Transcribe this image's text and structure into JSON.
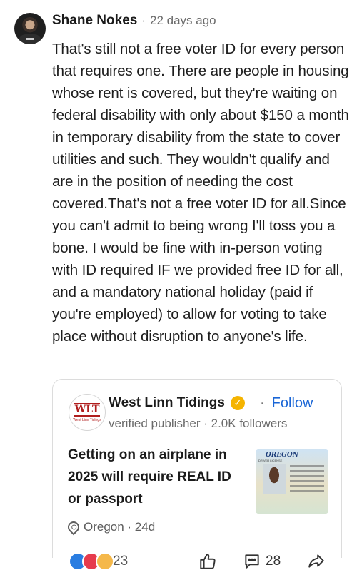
{
  "comment": {
    "author": "Shane Nokes",
    "separator": "·",
    "time": "22 days ago",
    "body": "That's still not a free voter ID for every person that requires one. There are people in housing whose rent is covered, but they're waiting on federal disability with only about $150 a month in temporary disability from the state to cover utilities and such. They wouldn't qualify and are in the position of needing the cost covered.That's not a free voter ID for all.Since you can't admit to being wrong I'll toss you a bone. I would be fine with in-person voting with ID required IF we provided free ID for all, and a mandatory national holiday (paid if you're employed) to allow for voting to take place without disruption to anyone's life."
  },
  "card": {
    "logo_text": "WLT",
    "logo_subtext": "West Linn Tidings",
    "publisher": "West Linn Tidings",
    "verified_icon": "verified-badge-icon",
    "follow_separator": "·",
    "follow_label": "Follow",
    "publisher_meta": "verified publisher · 2.0K followers",
    "headline": "Getting on an airplane in 2025 will require REAL ID or passport",
    "thumbnail_title": "OREGON",
    "thumbnail_caption": "DRIVER LICENSE",
    "location": "Oregon · 24d",
    "accent_color": "#1a66d6",
    "badge_color": "#f5b400"
  },
  "actions": {
    "reaction_icons": [
      "like-reaction-icon",
      "love-reaction-icon",
      "care-reaction-icon"
    ],
    "reaction_count": "23",
    "reply_count": "28"
  }
}
